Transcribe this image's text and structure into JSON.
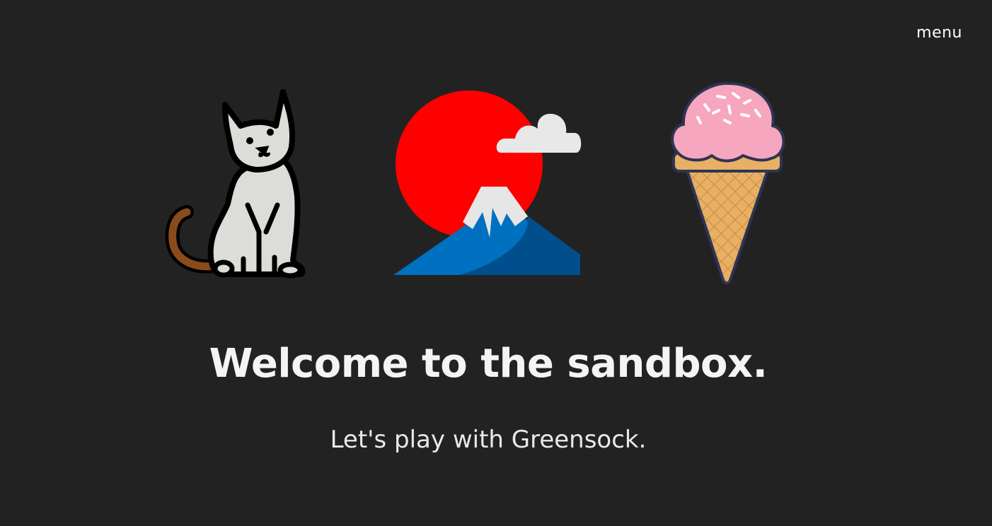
{
  "nav": {
    "menu_label": "menu"
  },
  "hero": {
    "illustrations": [
      "cat-illustration",
      "mount-fuji-illustration",
      "ice-cream-illustration"
    ],
    "title": "Welcome to the sandbox.",
    "subtitle": "Let's play with Greensock."
  },
  "colors": {
    "background": "#222222",
    "text": "#f2f2f2",
    "sun": "#ff0000",
    "mountain_blue": "#0070c0",
    "mountain_dark": "#004f8c",
    "snow": "#e6e6e6",
    "cat_body": "#dcdcd8",
    "cat_tail": "#8b4a1a",
    "scoop_pink": "#f7a6bf",
    "cone": "#e8b064",
    "outline_navy": "#2e3454"
  }
}
